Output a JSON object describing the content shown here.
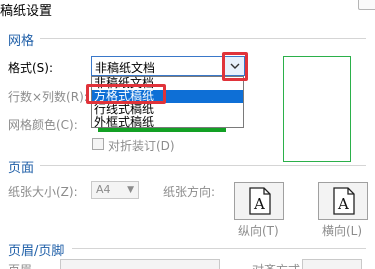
{
  "window": {
    "title": "稿纸设置"
  },
  "grid_section": {
    "title": "网格",
    "format_label": "格式(S):",
    "format_value": "非稿纸文档",
    "format_options": [
      "非稿纸文档",
      "方格式稿纸",
      "行线式稿纸",
      "外框式稿纸"
    ],
    "selected_index": 1,
    "rows_cols_label": "行数×列数(R):",
    "grid_color_label": "网格颜色(C):",
    "fold_checkbox_label": "对折装订(D)"
  },
  "page_section": {
    "title": "页面",
    "paper_size_label": "纸张大小(Z):",
    "paper_size_value": "A4",
    "orientation_label": "纸张方向:",
    "portrait_label": "纵向(T)",
    "landscape_label": "横向(L)"
  },
  "header_footer_section": {
    "title": "页眉/页脚",
    "header_label": "页眉",
    "alignment_label": "对齐方式"
  },
  "colors": {
    "accent": "#1f5fa8",
    "selection": "#0e6fd6",
    "highlight_red": "#e0333a",
    "grid_green": "#12a024"
  }
}
